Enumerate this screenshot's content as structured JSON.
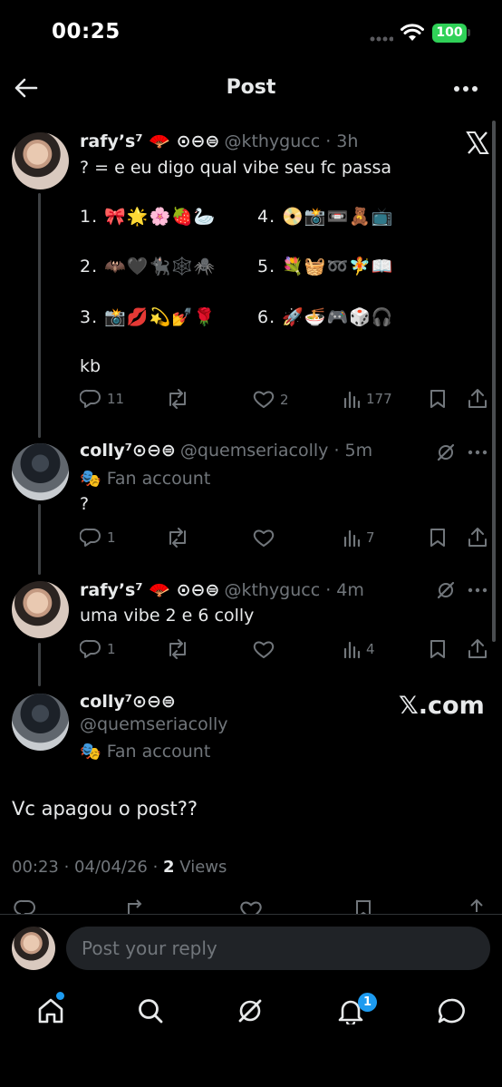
{
  "status_bar": {
    "time": "00:25",
    "battery": "100"
  },
  "header": {
    "title": "Post"
  },
  "tweets": [
    {
      "name": "rafy’s⁷ 🪭 ⊙⊖⊜",
      "handle": "@kthygucc",
      "time": "3h",
      "lines": [
        "? = e eu digo qual vibe seu fc passa",
        "1. 🎀🌟🌸🍓🦢",
        "4. 📀📸📼🧸📺",
        "2. 🦇🖤🐈‍⬛🕸️🕷️",
        "5. 💐🧺➿🧚📖",
        "3. 📸💋💫💅🌹",
        "6. 🚀🍜🎮🎲🎧",
        "kb"
      ],
      "replies": "11",
      "likes": "2",
      "views": "177"
    },
    {
      "name": "colly⁷⊙⊖⊜",
      "handle": "@quemseriacolly",
      "time": "5m",
      "label": "🎭 Fan account",
      "text": "?",
      "replies": "1",
      "views": "7"
    },
    {
      "name": "rafy’s⁷ 🪭 ⊙⊖⊜",
      "handle": "@kthygucc",
      "time": "4m",
      "text": "uma vibe 2 e 6 colly",
      "replies": "1",
      "views": "4"
    }
  ],
  "main_post": {
    "name": "colly⁷⊙⊖⊜",
    "handle": "@quemseriacolly",
    "label": "🎭 Fan account",
    "source": "𝕏.com",
    "text": "Vc apagou o post??",
    "meta": "00:23 · 04/04/26 · ",
    "views_count": "2",
    "views_label": " Views"
  },
  "reply_bar": {
    "placeholder": "Post your reply"
  },
  "nav": {
    "notification_count": "1"
  },
  "colors": {
    "background": "#000000",
    "accent": "#1d9bf0",
    "muted": "#71767b",
    "text": "#e7e9ea",
    "battery": "#30d158"
  }
}
